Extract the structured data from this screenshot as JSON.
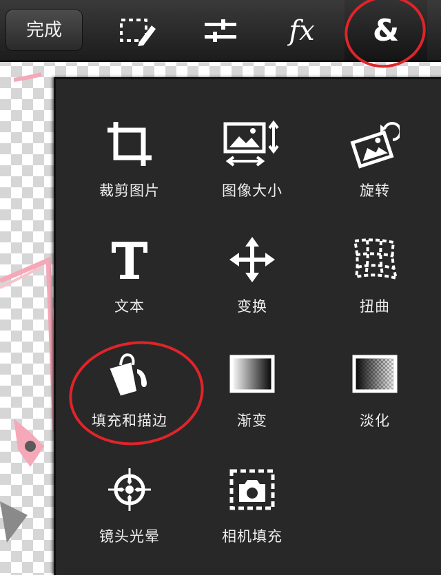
{
  "toolbar": {
    "done_label": "完成",
    "icons": [
      "selection-edit-icon",
      "adjust-sliders-icon",
      "fx-icon",
      "ampersand-icon"
    ],
    "fx_label": "fx",
    "amp_label": "&"
  },
  "menu": {
    "items": [
      {
        "label": "裁剪图片",
        "icon": "crop-icon"
      },
      {
        "label": "图像大小",
        "icon": "image-size-icon"
      },
      {
        "label": "旋转",
        "icon": "rotate-icon"
      },
      {
        "label": "文本",
        "icon": "text-icon"
      },
      {
        "label": "变换",
        "icon": "transform-icon"
      },
      {
        "label": "扭曲",
        "icon": "distort-icon"
      },
      {
        "label": "填充和描边",
        "icon": "fill-bucket-icon"
      },
      {
        "label": "渐变",
        "icon": "gradient-icon"
      },
      {
        "label": "淡化",
        "icon": "fade-icon"
      },
      {
        "label": "镜头光晕",
        "icon": "lens-flare-icon"
      },
      {
        "label": "相机填充",
        "icon": "camera-fill-icon"
      }
    ]
  },
  "colors": {
    "annotation_red": "#e0242a",
    "panel_bg": "#282828",
    "canvas_pink": "#f4a8b8"
  }
}
